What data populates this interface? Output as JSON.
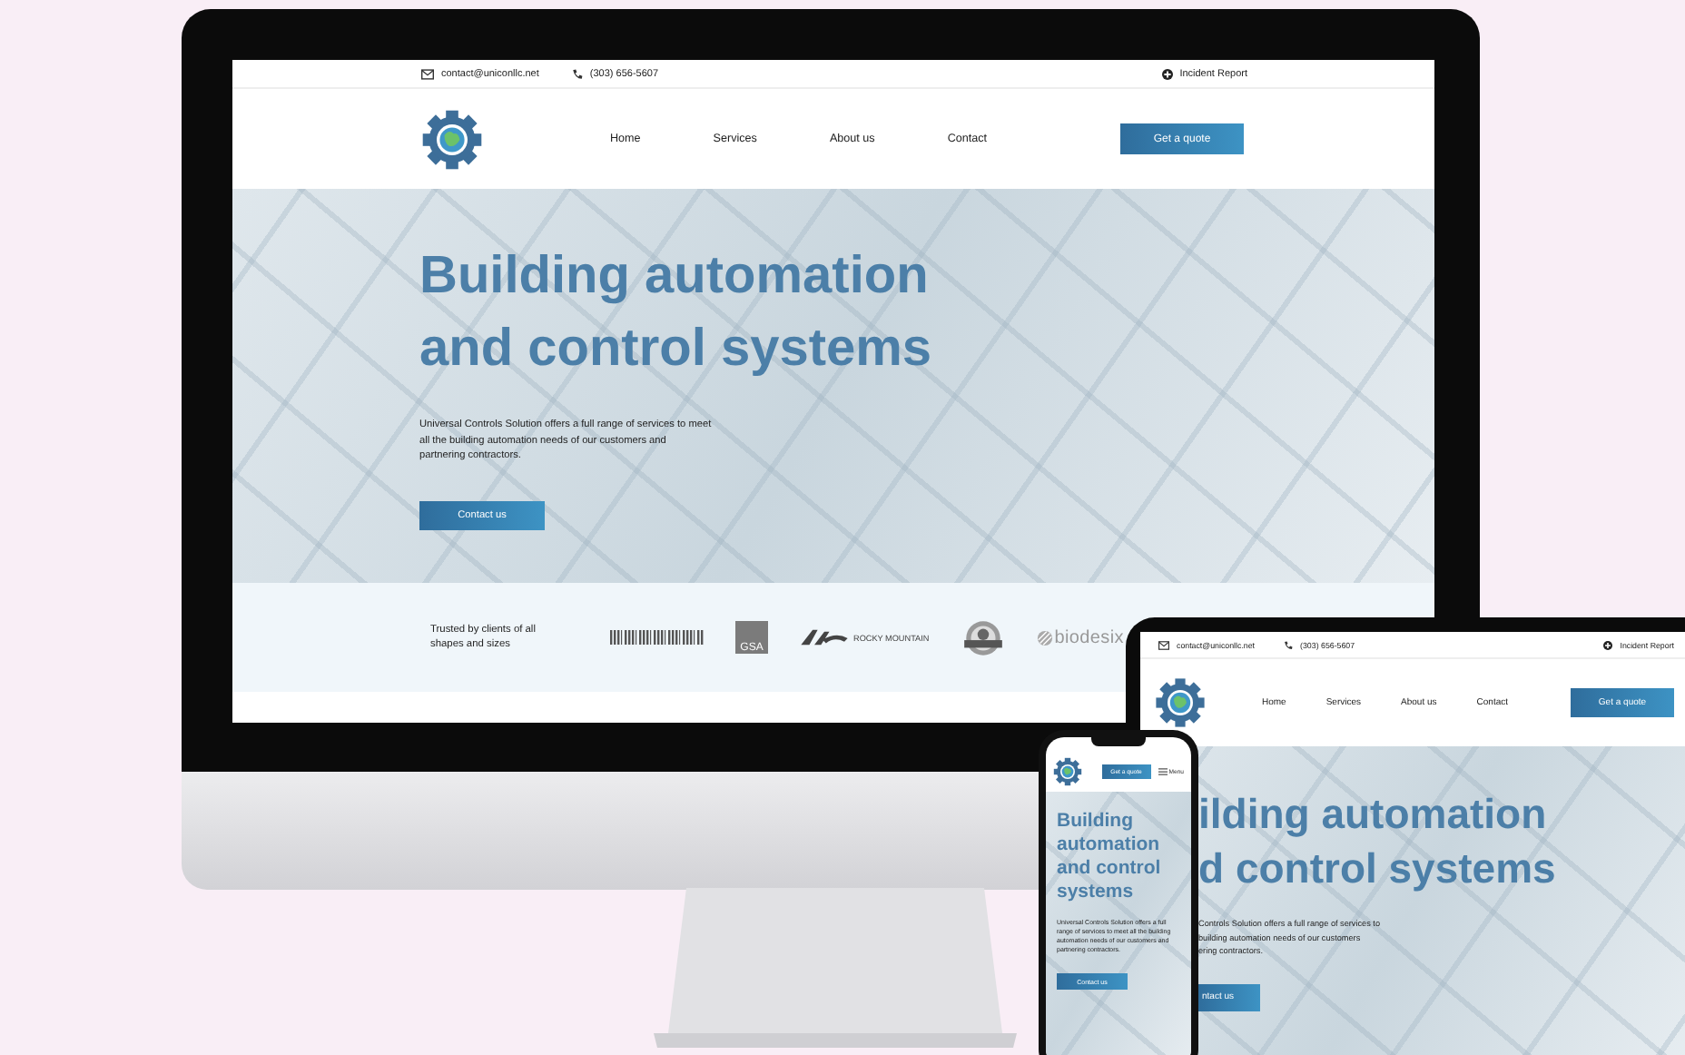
{
  "desktop": {
    "topbar": {
      "email": "contact@uniconllc.net",
      "phone": "(303) 656-5607",
      "report": "Incident Report"
    },
    "nav": [
      "Home",
      "Services",
      "About us",
      "Contact"
    ],
    "cta": "Get a quote",
    "hero": {
      "title_lines": [
        "Building automation",
        "and control systems"
      ],
      "text": "Universal Controls Solution offers a full range of services to meet all the building automation needs of our customers and partnering contractors.",
      "button": "Contact us"
    },
    "clients": {
      "label": "Trusted by clients of all shapes and sizes",
      "logos": [
        {
          "kind": "stripes"
        },
        {
          "kind": "badge",
          "text": "GSA"
        },
        {
          "kind": "swoosh",
          "text": "ROCKY MOUNTAIN"
        },
        {
          "kind": "seal"
        },
        {
          "kind": "wordmark",
          "text": "biodesix"
        }
      ]
    }
  },
  "tablet": {
    "topbar": {
      "email": "contact@uniconllc.net",
      "phone": "(303) 656-5607",
      "report": "Incident Report"
    },
    "nav": [
      "Home",
      "Services",
      "About us",
      "Contact"
    ],
    "cta": "Get a quote",
    "hero": {
      "title_lines": [
        "ilding automation",
        "d control systems"
      ],
      "text": "Controls Solution offers a full range of services to\nbuilding automation needs of our customers\nering contractors.",
      "button": "ntact us"
    }
  },
  "phone": {
    "cta": "Get a quote",
    "menu": "Menu",
    "hero": {
      "title_lines": [
        "Building",
        "automation",
        "and control",
        "systems"
      ],
      "text": "Universal Controls Solution offers a full range of services to meet all the building automation needs of our customers and partnering contractors.",
      "button": "Contact us"
    }
  }
}
